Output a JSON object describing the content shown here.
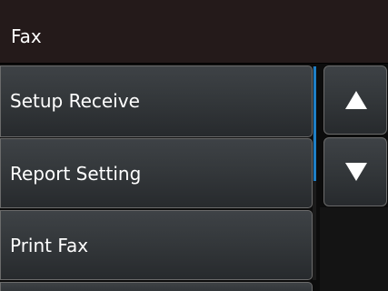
{
  "header": {
    "title": "Fax"
  },
  "menu": {
    "items": [
      {
        "label": "Setup Receive"
      },
      {
        "label": "Report Setting"
      },
      {
        "label": "Print Fax"
      },
      {
        "label": ""
      }
    ]
  },
  "nav": {
    "up_icon": "triangle-up-icon",
    "down_icon": "triangle-down-icon"
  },
  "colors": {
    "header_bg": "#241a1a",
    "button_bg": "#34383b",
    "scroll_accent": "#1f7fc6",
    "text": "#ffffff"
  }
}
